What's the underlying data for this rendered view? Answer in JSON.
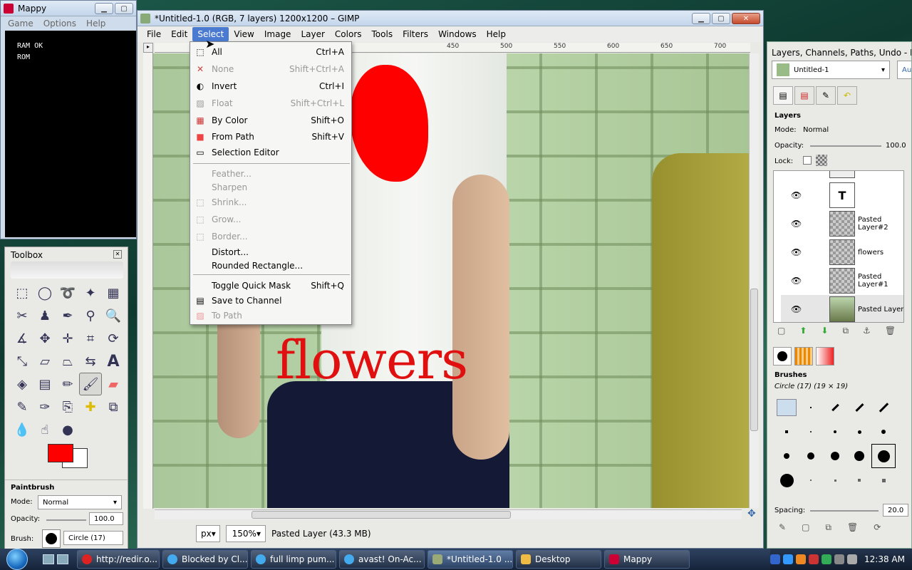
{
  "mappy": {
    "title": "Mappy",
    "menu": [
      "Game",
      "Options",
      "Help"
    ],
    "screen_lines": [
      "RAM OK",
      "ROM"
    ]
  },
  "toolbox": {
    "title": "Toolbox",
    "paintbrush_label": "Paintbrush",
    "mode_label": "Mode:",
    "mode_value": "Normal",
    "opacity_label": "Opacity:",
    "opacity_value": "100.0",
    "brush_label": "Brush:",
    "brush_value": "Circle (17)",
    "fg_color": "#ff0000",
    "bg_color": "#ffffff"
  },
  "gimp": {
    "title": "*Untitled-1.0 (RGB, 7 layers) 1200x1200 – GIMP",
    "menu": [
      "File",
      "Edit",
      "Select",
      "View",
      "Image",
      "Layer",
      "Colors",
      "Tools",
      "Filters",
      "Windows",
      "Help"
    ],
    "open_menu": "Select",
    "ruler_ticks": [
      "450",
      "500",
      "550",
      "600",
      "650",
      "700"
    ],
    "canvas_text": "flowers",
    "unit": "px",
    "zoom": "150%",
    "status": "Pasted Layer (43.3 MB)"
  },
  "select_menu": {
    "items": [
      {
        "label": "All",
        "shortcut": "Ctrl+A",
        "icon": "select-all-icon",
        "disabled": false
      },
      {
        "label": "None",
        "shortcut": "Shift+Ctrl+A",
        "icon": "select-none-icon",
        "disabled": true
      },
      {
        "label": "Invert",
        "shortcut": "Ctrl+I",
        "icon": "invert-icon",
        "disabled": false
      },
      {
        "label": "Float",
        "shortcut": "Shift+Ctrl+L",
        "icon": "float-icon",
        "disabled": true
      },
      {
        "label": "By Color",
        "shortcut": "Shift+O",
        "icon": "by-color-icon",
        "disabled": false
      },
      {
        "label": "From Path",
        "shortcut": "Shift+V",
        "icon": "from-path-icon",
        "disabled": false
      },
      {
        "label": "Selection Editor",
        "shortcut": "",
        "icon": "selection-editor-icon",
        "disabled": false
      },
      {
        "label": "Feather...",
        "shortcut": "",
        "icon": "",
        "disabled": true
      },
      {
        "label": "Sharpen",
        "shortcut": "",
        "icon": "",
        "disabled": true
      },
      {
        "label": "Shrink...",
        "shortcut": "",
        "icon": "shrink-icon",
        "disabled": true
      },
      {
        "label": "Grow...",
        "shortcut": "",
        "icon": "grow-icon",
        "disabled": true
      },
      {
        "label": "Border...",
        "shortcut": "",
        "icon": "border-icon",
        "disabled": true
      },
      {
        "label": "Distort...",
        "shortcut": "",
        "icon": "",
        "disabled": false
      },
      {
        "label": "Rounded Rectangle...",
        "shortcut": "",
        "icon": "",
        "disabled": false
      },
      {
        "label": "Toggle Quick Mask",
        "shortcut": "Shift+Q",
        "icon": "",
        "disabled": false
      },
      {
        "label": "Save to Channel",
        "shortcut": "",
        "icon": "save-channel-icon",
        "disabled": false
      },
      {
        "label": "To Path",
        "shortcut": "",
        "icon": "to-path-icon",
        "disabled": true
      }
    ]
  },
  "dock": {
    "title": "Layers, Channels, Paths, Undo - Br...",
    "image_select": "Untitled-1",
    "auto_label": "Auto",
    "layers_label": "Layers",
    "mode_label": "Mode:",
    "mode_value": "Normal",
    "opacity_label": "Opacity:",
    "opacity_value": "100.0",
    "lock_label": "Lock:",
    "layers": [
      "",
      "Pasted Layer#2",
      "flowers",
      "Pasted Layer#1",
      "Pasted Layer"
    ],
    "brushes_label": "Brushes",
    "brush_name": "Circle (17) (19 × 19)",
    "spacing_label": "Spacing:",
    "spacing_value": "20.0"
  },
  "taskbar": {
    "items": [
      {
        "label": "http://redir.o...",
        "icon": "opera-icon"
      },
      {
        "label": "Blocked by Cl...",
        "icon": "ie-icon"
      },
      {
        "label": "full limp pum...",
        "icon": "ie-icon"
      },
      {
        "label": "avast! On-Ac...",
        "icon": "ie-icon"
      },
      {
        "label": "*Untitled-1.0 ...",
        "icon": "gimp-icon"
      },
      {
        "label": "Desktop",
        "icon": "folder-icon"
      },
      {
        "label": "Mappy",
        "icon": "mappy-icon"
      }
    ],
    "clock": "12:38 AM"
  }
}
